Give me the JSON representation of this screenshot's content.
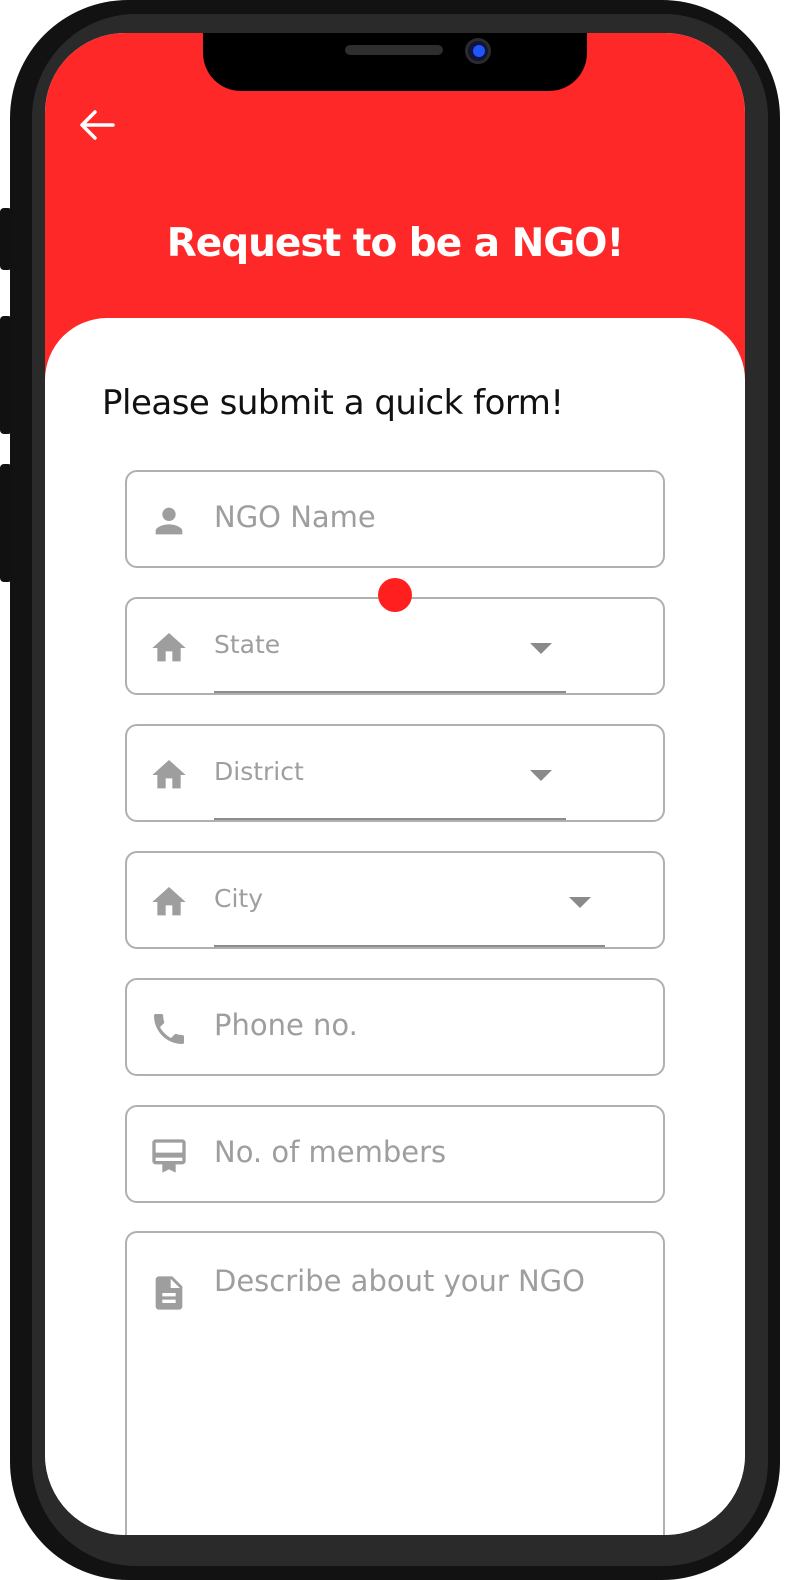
{
  "header": {
    "title": "Request to be a NGO!",
    "back_icon": "arrow-left-icon",
    "background_color": "#ff2828"
  },
  "form": {
    "subtitle": "Please submit a quick form!",
    "fields": {
      "ngo_name": {
        "placeholder": "NGO Name",
        "icon": "person-icon"
      },
      "state": {
        "placeholder": "State",
        "icon": "home-icon"
      },
      "district": {
        "placeholder": "District",
        "icon": "home-icon"
      },
      "city": {
        "placeholder": "City",
        "icon": "home-icon"
      },
      "phone": {
        "placeholder": "Phone no.",
        "icon": "phone-icon"
      },
      "members": {
        "placeholder": "No. of members",
        "icon": "card-membership-icon"
      },
      "description": {
        "placeholder": "Describe about your NGO",
        "icon": "document-icon"
      }
    }
  },
  "colors": {
    "accent": "#ff2828",
    "field_border": "#b0b0b0",
    "placeholder": "#9e9e9e"
  }
}
